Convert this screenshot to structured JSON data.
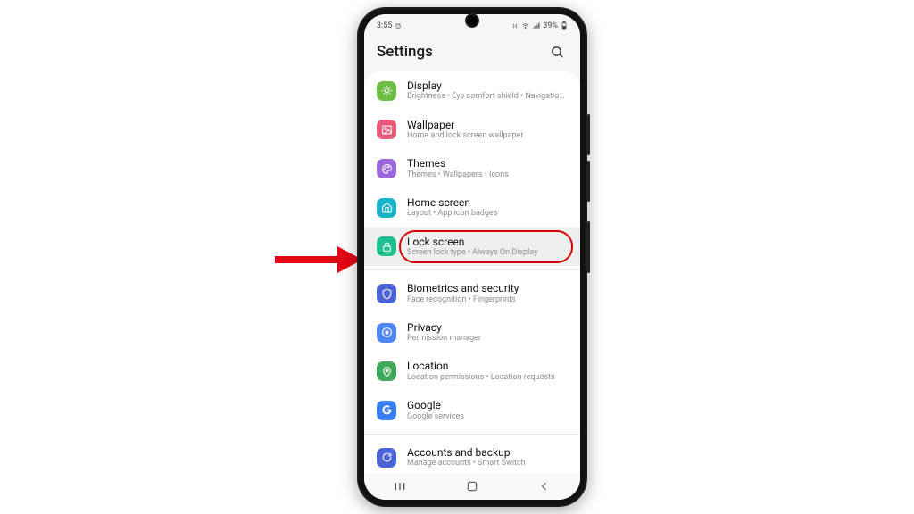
{
  "status": {
    "time": "3:55",
    "battery_text": "39%"
  },
  "header": {
    "title": "Settings"
  },
  "settings": [
    {
      "key": "display",
      "title": "Display",
      "sub": "Brightness • Eye comfort shield • Navigation bar",
      "color": "#6dbd45",
      "icon": "sun",
      "highlight": false,
      "sep": false
    },
    {
      "key": "wallpaper",
      "title": "Wallpaper",
      "sub": "Home and lock screen wallpaper",
      "color": "#e85a7a",
      "icon": "image",
      "highlight": false,
      "sep": false
    },
    {
      "key": "themes",
      "title": "Themes",
      "sub": "Themes • Wallpapers • Icons",
      "color": "#9a66d9",
      "icon": "palette",
      "highlight": false,
      "sep": false
    },
    {
      "key": "home",
      "title": "Home screen",
      "sub": "Layout • App icon badges",
      "color": "#17b3c9",
      "icon": "home",
      "highlight": false,
      "sep": false
    },
    {
      "key": "lock",
      "title": "Lock screen",
      "sub": "Screen lock type • Always On Display",
      "color": "#1fbf8f",
      "icon": "lock",
      "highlight": true,
      "sep": false
    },
    {
      "key": "biometrics",
      "title": "Biometrics and security",
      "sub": "Face recognition • Fingerprints",
      "color": "#4a63d6",
      "icon": "shield",
      "highlight": false,
      "sep": true
    },
    {
      "key": "privacy",
      "title": "Privacy",
      "sub": "Permission manager",
      "color": "#4f86f0",
      "icon": "privacy",
      "highlight": false,
      "sep": false
    },
    {
      "key": "location",
      "title": "Location",
      "sub": "Location permissions • Location requests",
      "color": "#3fa85a",
      "icon": "pin",
      "highlight": false,
      "sep": false
    },
    {
      "key": "google",
      "title": "Google",
      "sub": "Google services",
      "color": "#3a7df0",
      "icon": "google",
      "highlight": false,
      "sep": false
    },
    {
      "key": "accounts",
      "title": "Accounts and backup",
      "sub": "Manage accounts • Smart Switch",
      "color": "#4a63d6",
      "icon": "sync",
      "highlight": false,
      "sep": true
    }
  ],
  "annotation": {
    "arrow_color": "#e30613",
    "target_key": "lock"
  }
}
